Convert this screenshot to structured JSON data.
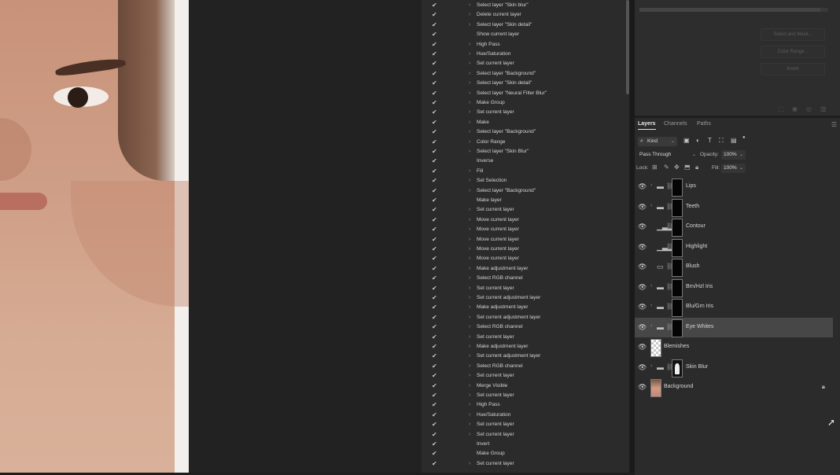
{
  "history": {
    "items": [
      {
        "label": "Select layer \"Skin blur\"",
        "arrow": true
      },
      {
        "label": "Delete current layer",
        "arrow": true
      },
      {
        "label": "Select layer \"Skin detail\"",
        "arrow": true
      },
      {
        "label": "Show current layer",
        "arrow": false
      },
      {
        "label": "High Pass",
        "arrow": true
      },
      {
        "label": "Hue/Saturation",
        "arrow": true
      },
      {
        "label": "Set current layer",
        "arrow": true
      },
      {
        "label": "Select layer \"Background\"",
        "arrow": true
      },
      {
        "label": "Select layer \"Skin detail\"",
        "arrow": true
      },
      {
        "label": "Select layer \"Neural Filter Blur\"",
        "arrow": true
      },
      {
        "label": "Make Group",
        "arrow": true
      },
      {
        "label": "Set current layer",
        "arrow": true
      },
      {
        "label": "Make",
        "arrow": true
      },
      {
        "label": "Select layer \"Background\"",
        "arrow": true
      },
      {
        "label": "Color Range",
        "arrow": true
      },
      {
        "label": "Select layer \"Skin Blur\"",
        "arrow": true
      },
      {
        "label": "Inverse",
        "arrow": false
      },
      {
        "label": "Fill",
        "arrow": true
      },
      {
        "label": "Set Selection",
        "arrow": true
      },
      {
        "label": "Select layer \"Background\"",
        "arrow": true
      },
      {
        "label": "Make layer",
        "arrow": false
      },
      {
        "label": "Set current layer",
        "arrow": true
      },
      {
        "label": "Move current layer",
        "arrow": true
      },
      {
        "label": "Move current layer",
        "arrow": true
      },
      {
        "label": "Move current layer",
        "arrow": true
      },
      {
        "label": "Move current layer",
        "arrow": true
      },
      {
        "label": "Move current layer",
        "arrow": true
      },
      {
        "label": "Make adjustment layer",
        "arrow": true
      },
      {
        "label": "Select RGB channel",
        "arrow": true
      },
      {
        "label": "Set current layer",
        "arrow": true
      },
      {
        "label": "Set current adjustment layer",
        "arrow": true
      },
      {
        "label": "Make adjustment layer",
        "arrow": true
      },
      {
        "label": "Set current adjustment layer",
        "arrow": true
      },
      {
        "label": "Select RGB channel",
        "arrow": true
      },
      {
        "label": "Set current layer",
        "arrow": true
      },
      {
        "label": "Make adjustment layer",
        "arrow": true
      },
      {
        "label": "Set current adjustment layer",
        "arrow": true
      },
      {
        "label": "Select RGB channel",
        "arrow": true
      },
      {
        "label": "Set current layer",
        "arrow": true
      },
      {
        "label": "Merge Visible",
        "arrow": true
      },
      {
        "label": "Set current layer",
        "arrow": true
      },
      {
        "label": "High Pass",
        "arrow": true
      },
      {
        "label": "Hue/Saturation",
        "arrow": true
      },
      {
        "label": "Set current layer",
        "arrow": true
      },
      {
        "label": "Set current layer",
        "arrow": true
      },
      {
        "label": "Invert",
        "arrow": false
      },
      {
        "label": "Make Group",
        "arrow": false
      },
      {
        "label": "Set current layer",
        "arrow": true
      }
    ]
  },
  "properties": {
    "buttons": [
      "Select and Mask...",
      "Color Range...",
      "Invert"
    ]
  },
  "layers_panel": {
    "tabs": [
      "Layers",
      "Channels",
      "Paths"
    ],
    "filter_kind": "Kind",
    "blend_mode": "Pass Through",
    "opacity_label": "Opacity:",
    "opacity_value": "100%",
    "lock_label": "Lock:",
    "fill_label": "Fill:",
    "fill_value": "100%",
    "layers": [
      {
        "name": "Lips",
        "type": "group",
        "selected": false
      },
      {
        "name": "Teeth",
        "type": "group",
        "selected": false
      },
      {
        "name": "Contour",
        "type": "levels",
        "selected": false
      },
      {
        "name": "Highlight",
        "type": "levels",
        "selected": false
      },
      {
        "name": "Blush",
        "type": "image",
        "selected": false
      },
      {
        "name": "Brn/Hzl Iris",
        "type": "group",
        "selected": false
      },
      {
        "name": "Blu/Grn Iris",
        "type": "group",
        "selected": false
      },
      {
        "name": "Eye Whites",
        "type": "group",
        "selected": true
      },
      {
        "name": "Blemishes",
        "type": "pixel",
        "selected": false
      },
      {
        "name": "Skin Blur",
        "type": "group-silhouette",
        "selected": false
      },
      {
        "name": "Background",
        "type": "background",
        "selected": false
      }
    ]
  }
}
